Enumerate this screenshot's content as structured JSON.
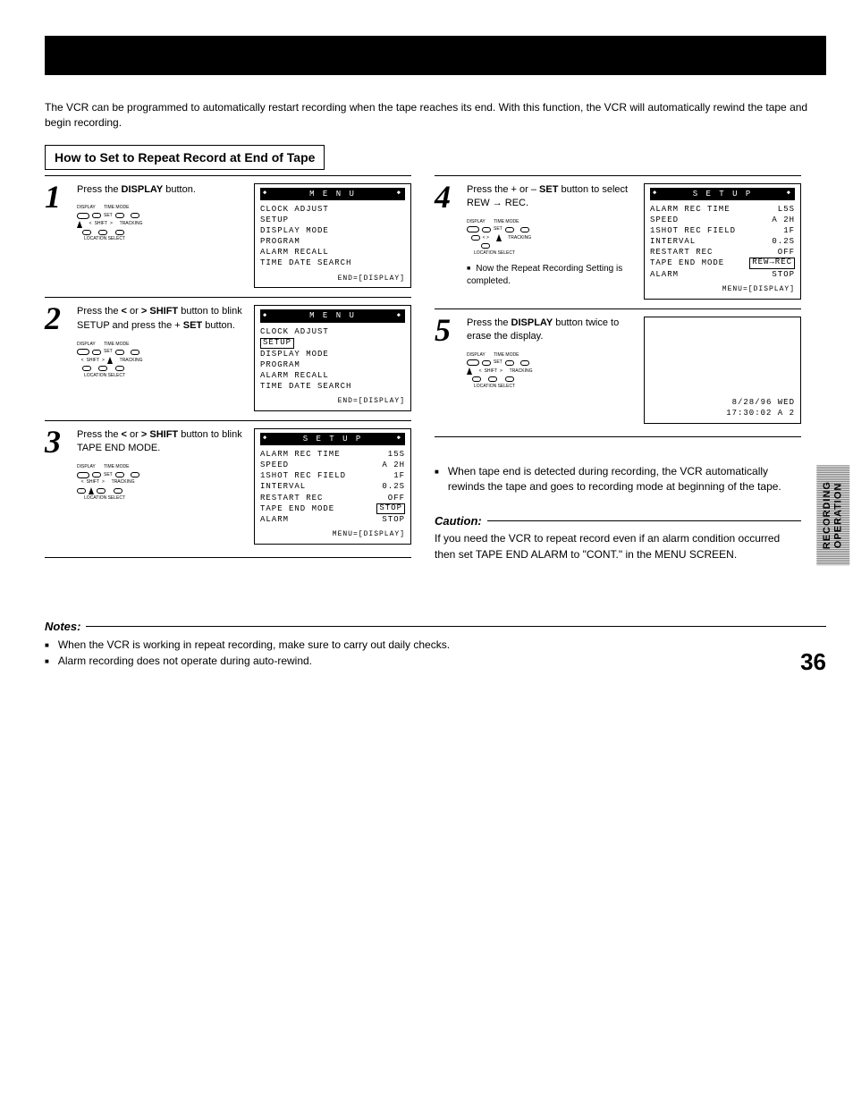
{
  "sideTab": {
    "line1": "RECORDING",
    "line2": "OPERATION"
  },
  "intro": "The VCR can be programmed to automatically restart recording when the tape reaches its end. With this function, the VCR will automatically rewind the tape and begin recording.",
  "howtoTitle": "How to Set to Repeat Record at End of Tape",
  "steps": {
    "s1": {
      "num": "1",
      "prefix": "Press the ",
      "strong": "DISPLAY",
      "suffix": " button."
    },
    "s2": {
      "num": "2",
      "t1": "Press the ",
      "sym1": "<",
      "mid1": " or ",
      "sym2": ">",
      "t2": " ",
      "b1": "SHIFT",
      "t3": " button to blink SETUP and press the + ",
      "b2": "SET",
      "t4": " button."
    },
    "s3": {
      "num": "3",
      "t1": "Press the ",
      "sym1": "<",
      "mid1": " or ",
      "sym2": ">",
      "t2": " ",
      "b1": "SHIFT",
      "t3": " button to blink TAPE END MODE."
    },
    "s4": {
      "num": "4",
      "t1": "Press the + or – ",
      "b1": "SET",
      "t2": " button to select REW → REC.",
      "sub": "Now the Repeat Recording Setting is completed."
    },
    "s5": {
      "num": "5",
      "t1": "Press the ",
      "b1": "DISPLAY",
      "t2": " button twice to erase the display."
    }
  },
  "osd": {
    "menu": {
      "title": "M E N U",
      "items": [
        "CLOCK ADJUST",
        "SETUP",
        "DISPLAY MODE",
        "PROGRAM",
        "ALARM RECALL",
        "TIME DATE SEARCH"
      ],
      "footer": "END=[DISPLAY]"
    },
    "menu2": {
      "title": "M E N U",
      "items": [
        "CLOCK ADJUST",
        "SETUP",
        "DISPLAY MODE",
        "PROGRAM",
        "ALARM RECALL",
        "TIME DATE SEARCH"
      ],
      "highlight": "SETUP",
      "footer": "END=[DISPLAY]"
    },
    "setup1": {
      "title": "S E T U P",
      "rows": [
        {
          "l": "ALARM REC TIME",
          "r": "15S"
        },
        {
          "l": "SPEED",
          "r": "A 2H"
        },
        {
          "l": "1SHOT REC FIELD",
          "r": "1F"
        },
        {
          "l": "INTERVAL",
          "r": "0.2S"
        },
        {
          "l": "RESTART REC",
          "r": "OFF"
        },
        {
          "l": "TAPE END MODE",
          "r": "STOP",
          "rbox": true
        },
        {
          "l": "ALARM",
          "r": "STOP"
        }
      ],
      "footer": "MENU=[DISPLAY]"
    },
    "setup2": {
      "title": "S E T U P",
      "rows": [
        {
          "l": "ALARM REC TIME",
          "r": "L5S"
        },
        {
          "l": "SPEED",
          "r": "A 2H"
        },
        {
          "l": "1SHOT REC FIELD",
          "r": "1F"
        },
        {
          "l": "INTERVAL",
          "r": "0.2S"
        },
        {
          "l": "RESTART REC",
          "r": "OFF"
        },
        {
          "l": "TAPE END MODE",
          "r": "REW→REC",
          "rbox": true
        },
        {
          "l": "ALARM",
          "r": "STOP"
        }
      ],
      "footer": "MENU=[DISPLAY]"
    },
    "blank": {
      "line1": "8/28/96 WED",
      "line2": "17:30:02 A 2"
    }
  },
  "controls": {
    "display": "DISPLAY",
    "timeMode": "TIME MODE",
    "set": "SET",
    "shift": "SHIFT",
    "tracking": "TRACKING",
    "locsel": "LOCATION SELECT"
  },
  "info": "When tape end is detected during recording, the VCR automatically rewinds the tape and goes to recording mode at beginning of the tape.",
  "cautionHead": "Caution:",
  "cautionText": "If you need the VCR to repeat record even if an alarm condition occurred then set TAPE END ALARM to \"CONT.\" in the MENU SCREEN.",
  "notesHead": "Notes:",
  "notes": [
    "When the VCR is working in repeat recording, make sure to carry out daily checks.",
    "Alarm recording does not operate during auto-rewind."
  ],
  "pageNum": "36"
}
